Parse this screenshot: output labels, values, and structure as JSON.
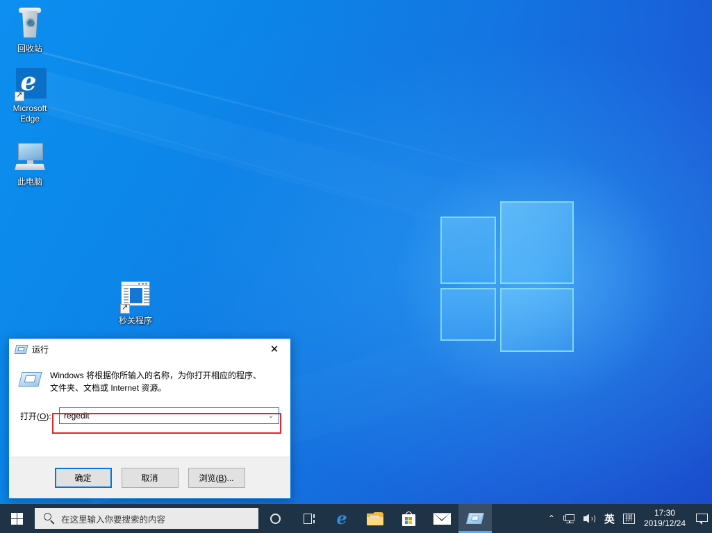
{
  "desktop": {
    "icons": [
      {
        "label": "回收站",
        "icon": "recycle-bin-icon"
      },
      {
        "label": "Microsoft\nEdge",
        "label_line1": "Microsoft",
        "label_line2": "Edge",
        "icon": "edge-icon"
      },
      {
        "label": "此电脑",
        "icon": "this-pc-icon"
      },
      {
        "label": "秒关程序",
        "icon": "application-shortcut-icon"
      }
    ],
    "wallpaper": "windows-10-hero-logo",
    "colors": {
      "bg_top_left": "#0d8ff0",
      "bg_bottom_right": "#1a44c6",
      "logo_stroke": "#8ce1ff"
    }
  },
  "run_dialog": {
    "title": "运行",
    "title_icon": "run-dialog-icon",
    "close_label": "✕",
    "description": "Windows 将根据你所输入的名称，为你打开相应的程序、文件夹、文档或 Internet 资源。",
    "description_line1": "Windows 将根据你所输入的名称，为你打开相应的程序、",
    "description_line2": "文件夹、文档或 Internet 资源。",
    "open_label": "打开(O):",
    "open_label_text": "打开(",
    "open_label_accel": "O",
    "open_label_suffix": "):",
    "input_value": "regedit",
    "dropdown_arrow": "⌄",
    "highlight_color": "#e8232a",
    "focus_color": "#0078d7",
    "buttons": [
      {
        "label": "确定",
        "name": "ok-button",
        "default": true
      },
      {
        "label": "取消",
        "name": "cancel-button",
        "default": false
      },
      {
        "label_prefix": "浏览(",
        "label_accel": "B",
        "label_suffix": ")...",
        "label": "浏览(B)...",
        "name": "browse-button",
        "default": false
      }
    ]
  },
  "taskbar": {
    "start_label": "开始",
    "search_placeholder": "在这里输入你要搜索的内容",
    "search_icon": "search-icon",
    "buttons": [
      {
        "name": "cortana-button",
        "icon": "cortana-icon",
        "active": false
      },
      {
        "name": "task-view-button",
        "icon": "task-view-icon",
        "active": false
      },
      {
        "name": "taskbar-edge",
        "icon": "edge-icon",
        "active": false
      },
      {
        "name": "taskbar-file-explorer",
        "icon": "file-explorer-icon",
        "active": false
      },
      {
        "name": "taskbar-microsoft-store",
        "icon": "microsoft-store-icon",
        "active": false
      },
      {
        "name": "taskbar-mail",
        "icon": "mail-icon",
        "active": false
      },
      {
        "name": "taskbar-run-dialog",
        "icon": "run-dialog-icon",
        "active": true
      }
    ],
    "tray": {
      "chevron": "⌃",
      "network_icon": "network-icon",
      "volume_icon": "volume-icon",
      "ime_language": "英",
      "ime_mode": "拼",
      "time": "17:30",
      "date": "2019/12/24",
      "notification_icon": "notification-icon"
    },
    "colors": {
      "bar": "#1f3346",
      "search_box": "#eaeaea",
      "active_underline": "#57a9f5"
    }
  }
}
